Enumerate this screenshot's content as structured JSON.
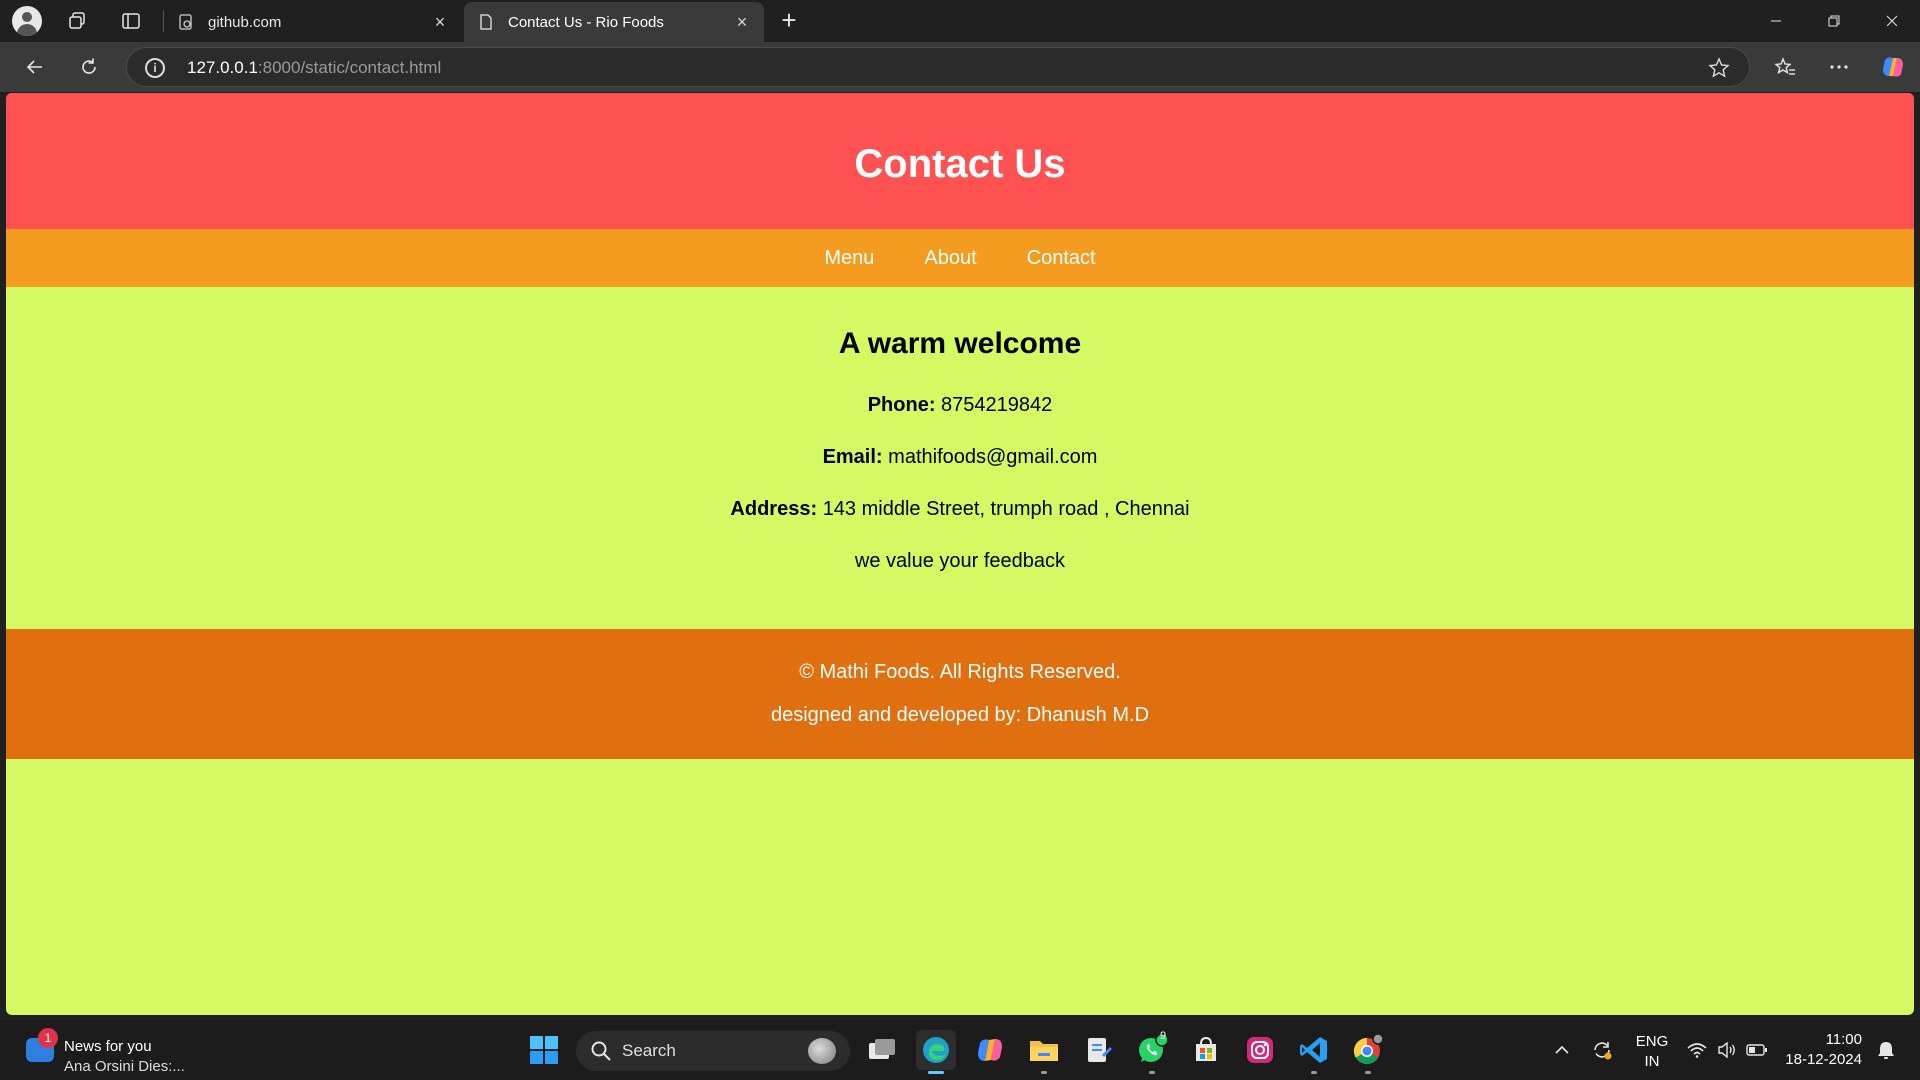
{
  "browser": {
    "tabs": [
      {
        "title": "github.com",
        "active": false
      },
      {
        "title": "Contact Us - Rio Foods",
        "active": true
      }
    ],
    "address": {
      "host": "127.0.0.1",
      "path": ":8000/static/contact.html"
    }
  },
  "page": {
    "header_title": "Contact Us",
    "nav": [
      "Menu",
      "About",
      "Contact"
    ],
    "welcome_heading": "A warm welcome",
    "phone_label": "Phone:",
    "phone_value": "8754219842",
    "email_label": "Email:",
    "email_value": "mathifoods@gmail.com",
    "address_label": "Address:",
    "address_value": "143 middle Street, trumph road , Chennai",
    "feedback": "we value your feedback",
    "footer_copyright": "© Mathi Foods. All Rights Reserved.",
    "footer_credit": "designed and developed by: Dhanush M.D",
    "colors": {
      "header": "#fe5152",
      "nav": "#f39c20",
      "body": "#d4f963",
      "footer": "#df6f0f"
    }
  },
  "taskbar": {
    "news_title": "News for you",
    "news_subtitle": "Ana Orsini Dies:...",
    "news_badge": "1",
    "search_label": "Search",
    "whatsapp_badge": "9",
    "lang_line1": "ENG",
    "lang_line2": "IN",
    "time": "11:00",
    "date": "18-12-2024"
  }
}
